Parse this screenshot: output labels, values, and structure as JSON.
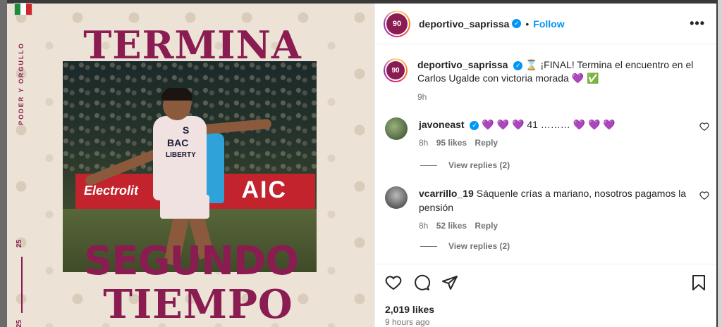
{
  "post": {
    "image_text": {
      "side_label": "PODER Y ORGULLO",
      "side_number": "25",
      "headline_top": "TERMINA",
      "headline_bottom_1": "SEGUNDO",
      "headline_bottom_2": "TIEMPO",
      "banner_text": "Electrolit",
      "banner_brand": "AIC",
      "jersey_s": "S",
      "jersey_bac": "BAC",
      "jersey_liberty": "LIBERTY"
    },
    "account": {
      "username": "deportivo_saprissa",
      "avatar_text": "90",
      "dot": "•",
      "follow_label": "Follow",
      "more_label": "•••"
    },
    "caption": {
      "username": "deportivo_saprissa",
      "text": "⌛ ¡FINAL! Termina el encuentro en el Carlos Ugalde con victoria morada 💜 ✅",
      "time": "9h"
    },
    "comments": [
      {
        "username": "javoneast",
        "text": "💜 💜 💜 41 ……… 💜 💜 💜",
        "time": "8h",
        "likes": "95 likes",
        "reply_label": "Reply",
        "view_replies": "View replies (2)",
        "verified": true
      },
      {
        "username": "vcarrillo_19",
        "text": "Sáquenle crías a mariano, nosotros pagamos la pensión",
        "time": "8h",
        "likes": "52 likes",
        "reply_label": "Reply",
        "view_replies": "View replies (2)",
        "verified": false
      }
    ],
    "likes": "2,019 likes",
    "ago": "9 hours ago"
  },
  "icons": {
    "like": "heart-icon",
    "comment": "comment-icon",
    "share": "share-icon",
    "save": "bookmark-icon",
    "verified": "verified-icon"
  },
  "colors": {
    "brand": "#8a1c52",
    "link": "#0095f6",
    "text": "#262626",
    "muted": "#737373"
  }
}
